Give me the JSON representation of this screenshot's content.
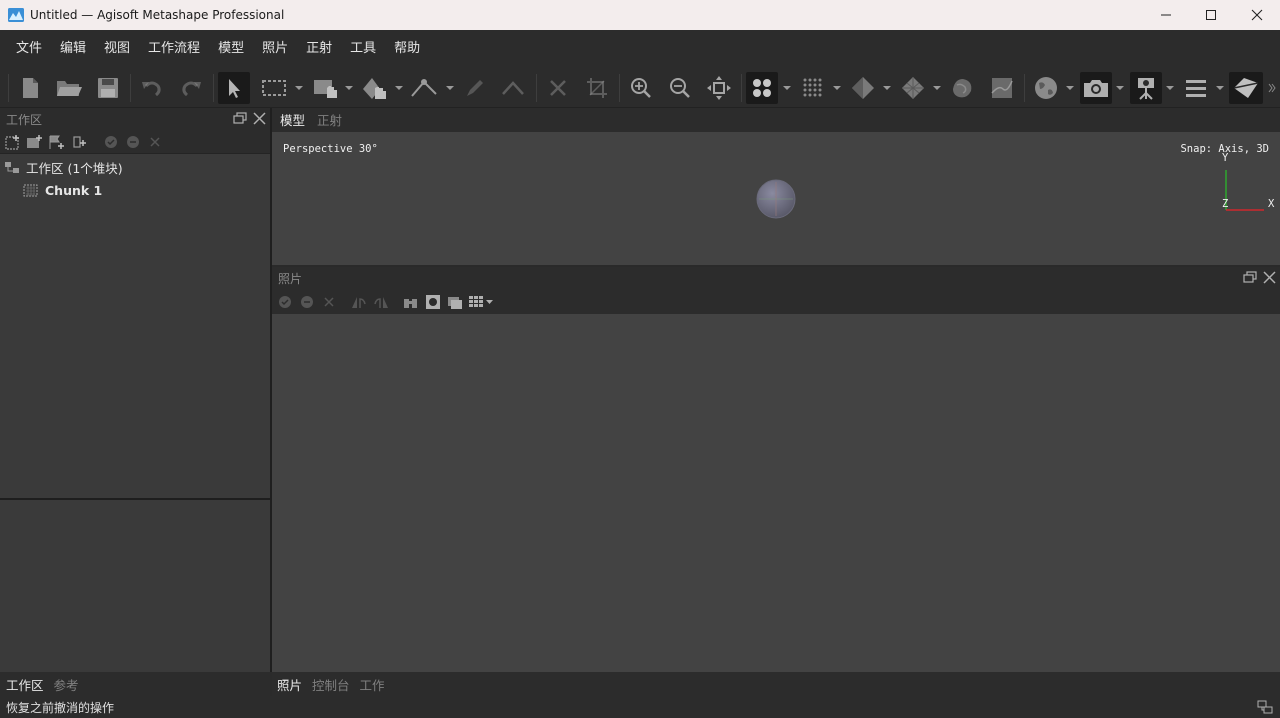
{
  "window": {
    "title": "Untitled — Agisoft Metashape Professional",
    "controls": [
      "minimize",
      "maximize",
      "close"
    ]
  },
  "menu": [
    "文件",
    "编辑",
    "视图",
    "工作流程",
    "模型",
    "照片",
    "正射",
    "工具",
    "帮助"
  ],
  "toolbar": {
    "buttons": [
      "new-document",
      "open-folder",
      "save",
      "undo",
      "redo",
      "navigation",
      "rectangle-selection",
      "resize-region",
      "rotate-object",
      "ruler",
      "draw-polyline",
      "draw-polygon",
      "delete",
      "crop",
      "zoom-in",
      "zoom-out",
      "reset-view",
      "points",
      "dense-points",
      "model",
      "tiled-model",
      "dem",
      "orthomosaic",
      "globe",
      "camera",
      "show-cameras",
      "menu-list",
      "show-shapes"
    ]
  },
  "workspace_panel": {
    "title": "工作区",
    "root_label": "工作区 (1个堆块)",
    "chunk_label": "Chunk 1",
    "bottom_tabs": [
      "工作区",
      "参考"
    ],
    "active_tab": "工作区"
  },
  "model_view": {
    "tabs": [
      "模型",
      "正射"
    ],
    "active_tab": "模型",
    "projection": "Perspective 30°",
    "snap": "Snap: Axis, 3D",
    "axes": {
      "y": "Y",
      "z": "Z",
      "x": "X"
    },
    "colors": {
      "axis_x": "#d0282c",
      "axis_y": "#2ea82e",
      "background": "#434343"
    }
  },
  "photos_panel": {
    "title": "照片"
  },
  "bottom_tabs": [
    "照片",
    "控制台",
    "工作"
  ],
  "bottom_active_tab": "照片",
  "status": {
    "text": "恢复之前撤消的操作"
  }
}
